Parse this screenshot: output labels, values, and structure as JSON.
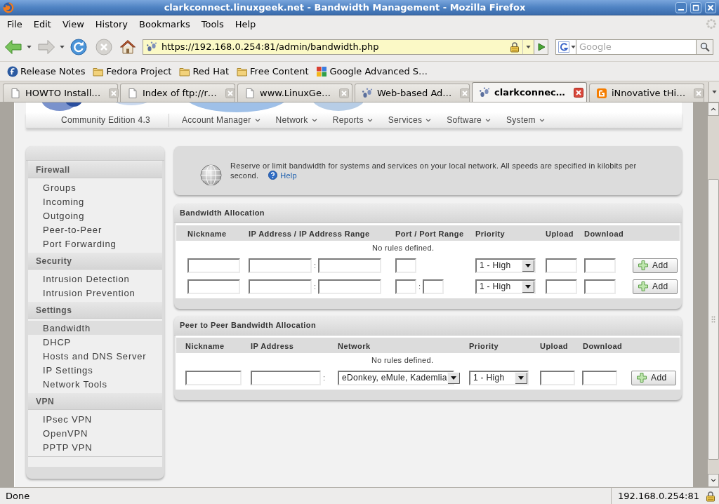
{
  "window": {
    "title": "clarkconnect.linuxgeek.net - Bandwidth Management - Mozilla Firefox"
  },
  "menu_bar": [
    {
      "label": "File"
    },
    {
      "label": "Edit"
    },
    {
      "label": "View"
    },
    {
      "label": "History"
    },
    {
      "label": "Bookmarks"
    },
    {
      "label": "Tools"
    },
    {
      "label": "Help"
    }
  ],
  "navigation": {
    "address": "https://192.168.0.254:81/admin/bandwidth.php",
    "secure": true,
    "search_placeholder": "Google"
  },
  "bookmarks": [
    {
      "label": "Release Notes",
      "kind": "fedora"
    },
    {
      "label": "Fedora Project",
      "kind": "folder"
    },
    {
      "label": "Red Hat",
      "kind": "folder"
    },
    {
      "label": "Free Content",
      "kind": "folder"
    },
    {
      "label": "Google Advanced S…",
      "kind": "google"
    }
  ],
  "tabs": [
    {
      "label": "HOWTO Install…",
      "kind": "page",
      "selected": false
    },
    {
      "label": "Index of ftp://r…",
      "kind": "page",
      "selected": false
    },
    {
      "label": "www.LinuxGe…",
      "kind": "page",
      "selected": false
    },
    {
      "label": "Web-based Ad…",
      "kind": "site",
      "selected": false
    },
    {
      "label": "clarkconnec…",
      "kind": "site",
      "selected": true
    },
    {
      "label": "iNnovative tHi…",
      "kind": "blogger",
      "selected": false
    }
  ],
  "page": {
    "header": {
      "edition": "Community Edition 4.3",
      "menu": [
        "Account Manager",
        "Network",
        "Reports",
        "Services",
        "Software",
        "System"
      ]
    },
    "sidebar": [
      {
        "title": "Firewall",
        "items": [
          {
            "label": "Groups",
            "selected": false
          },
          {
            "label": "Incoming",
            "selected": false
          },
          {
            "label": "Outgoing",
            "selected": false
          },
          {
            "label": "Peer-to-Peer",
            "selected": false
          },
          {
            "label": "Port Forwarding",
            "selected": false
          }
        ]
      },
      {
        "title": "Security",
        "items": [
          {
            "label": "Intrusion Detection",
            "selected": false
          },
          {
            "label": "Intrusion Prevention",
            "selected": false
          }
        ]
      },
      {
        "title": "Settings",
        "items": [
          {
            "label": "Bandwidth",
            "selected": true
          },
          {
            "label": "DHCP",
            "selected": false
          },
          {
            "label": "Hosts and DNS Server",
            "selected": false
          },
          {
            "label": "IP Settings",
            "selected": false
          },
          {
            "label": "Network Tools",
            "selected": false
          }
        ]
      },
      {
        "title": "VPN",
        "items": [
          {
            "label": "IPsec VPN",
            "selected": false
          },
          {
            "label": "OpenVPN",
            "selected": false
          },
          {
            "label": "PPTP VPN",
            "selected": false
          }
        ]
      }
    ],
    "intro": {
      "text": "Reserve or limit bandwidth for systems and services on your local network. All speeds are specified in kilobits per second.",
      "help_link": "Help"
    },
    "bandwidth_allocation": {
      "title": "Bandwidth Allocation",
      "columns": [
        "Nickname",
        "IP Address / IP Address Range",
        "Port / Port Range",
        "Priority",
        "Upload",
        "Download"
      ],
      "empty_message": "No rules defined.",
      "rows": [
        {
          "kind": "single_port",
          "ip_separator": ":",
          "priority": "1 - High",
          "button": "Add"
        },
        {
          "kind": "port_range",
          "ip_separator": ":",
          "port_separator": ":",
          "priority": "1 - High",
          "button": "Add"
        }
      ]
    },
    "peer_allocation": {
      "title": "Peer to Peer Bandwidth Allocation",
      "columns": [
        "Nickname",
        "IP Address",
        "Network",
        "Priority",
        "Upload",
        "Download"
      ],
      "empty_message": "No rules defined.",
      "rows": [
        {
          "ip_separator": ":",
          "network": "eDonkey, eMule, Kademlia",
          "priority": "1 - High",
          "button": "Add"
        }
      ]
    }
  },
  "status_bar": {
    "text": "Done",
    "host": "192.168.0.254:81"
  }
}
